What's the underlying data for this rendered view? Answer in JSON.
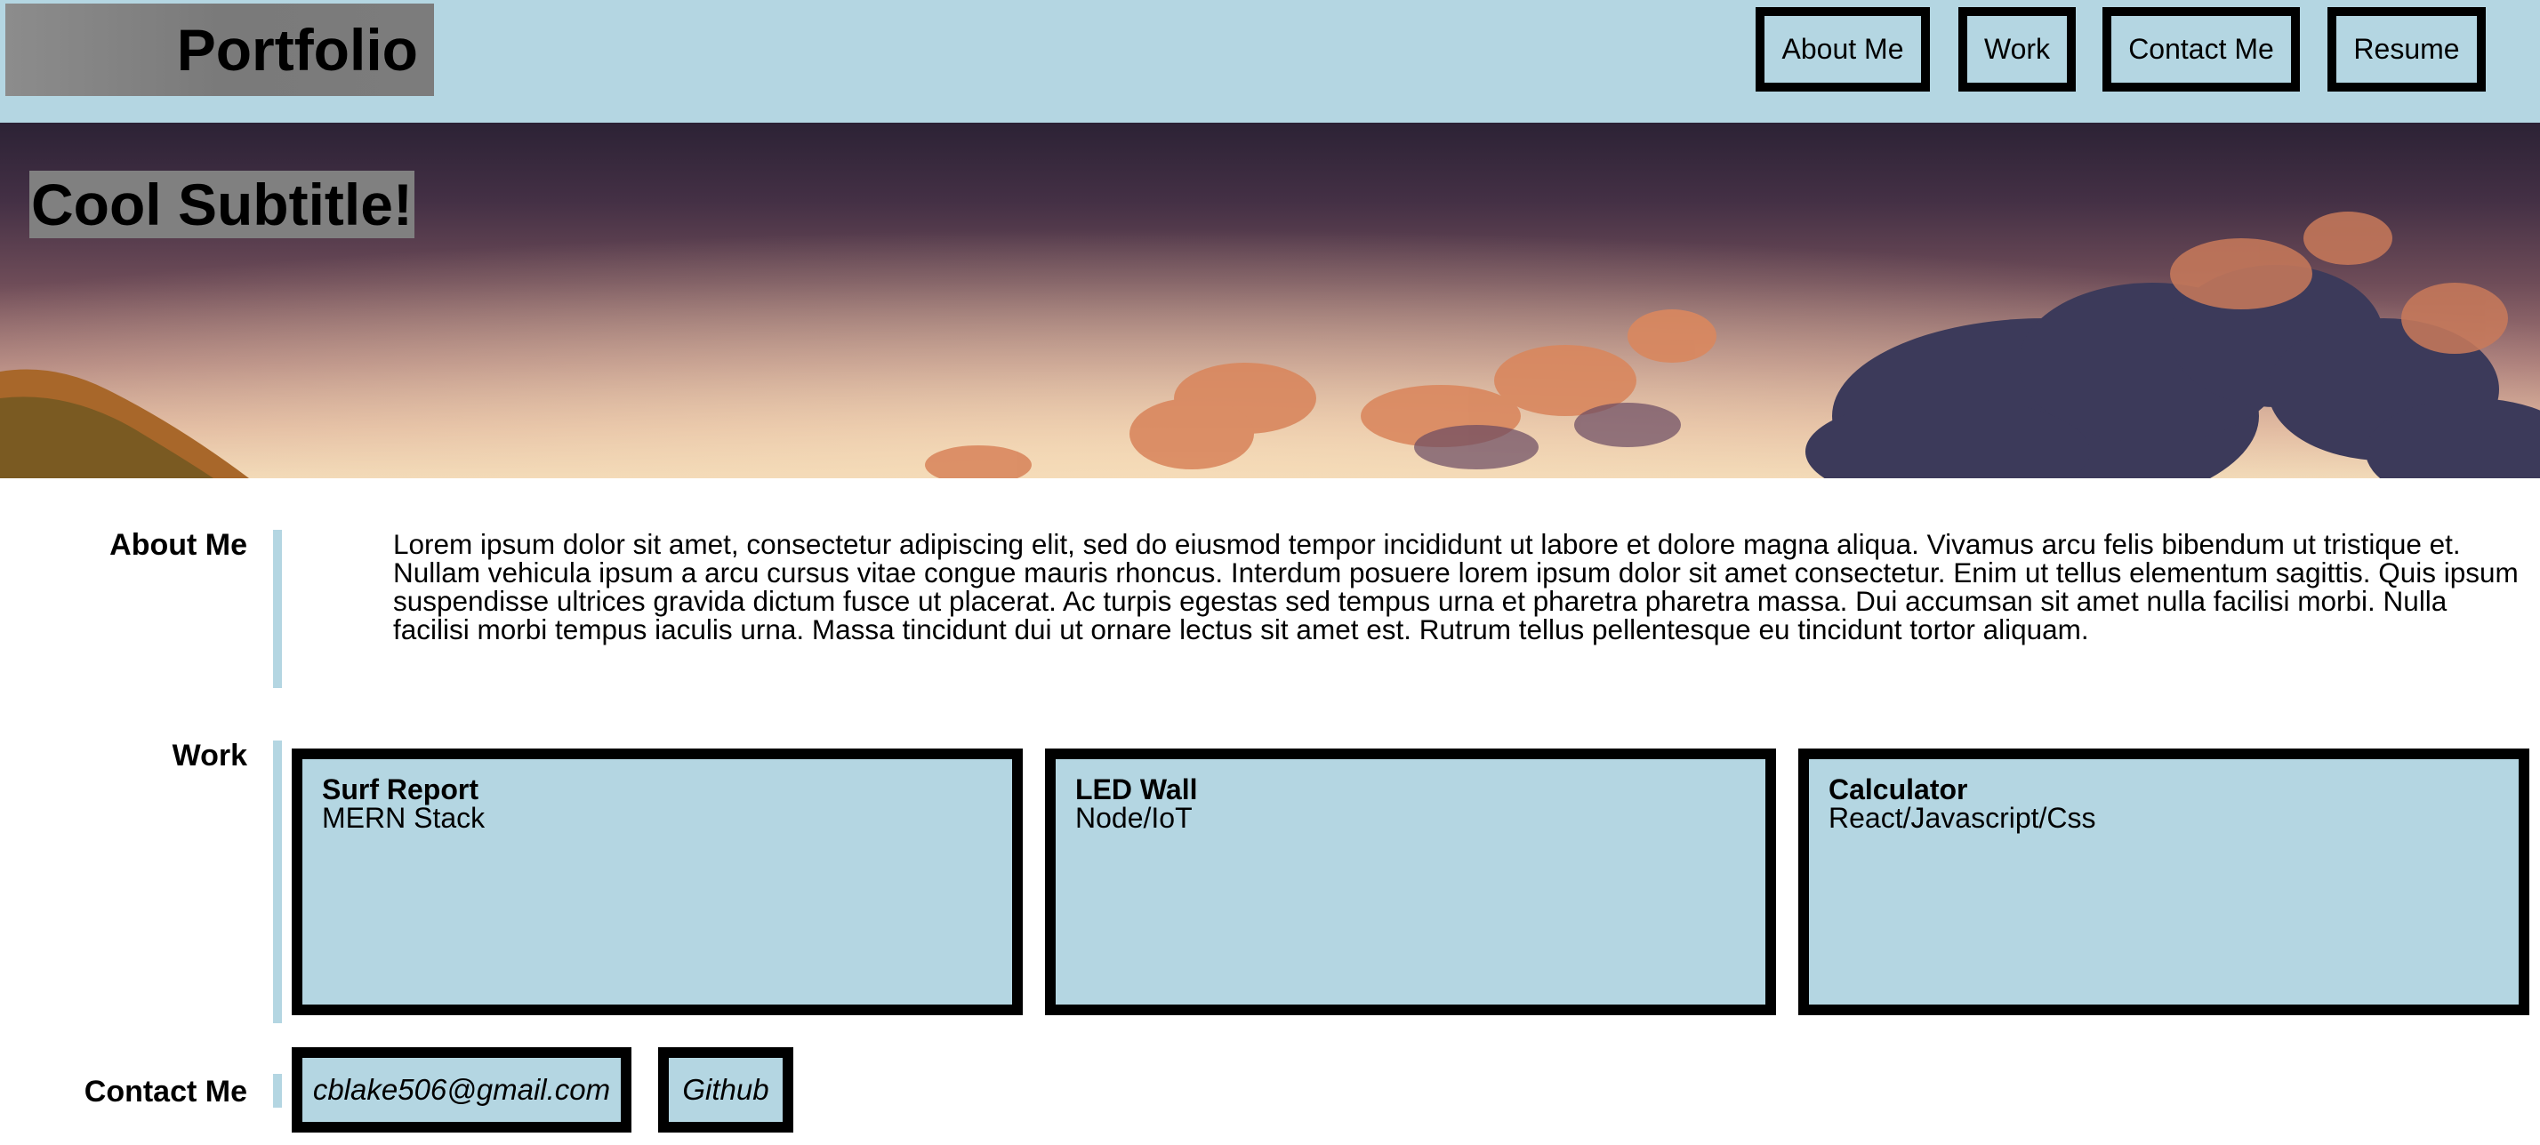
{
  "header": {
    "logo": "Portfolio",
    "nav": [
      "About Me",
      "Work",
      "Contact Me",
      "Resume"
    ]
  },
  "hero": {
    "subtitle": "Cool Subtitle!"
  },
  "about": {
    "label": "About Me",
    "text": "Lorem ipsum dolor sit amet, consectetur adipiscing elit, sed do eiusmod tempor incididunt ut labore et dolore magna aliqua. Vivamus arcu felis bibendum ut tristique et. Nullam vehicula ipsum a arcu cursus vitae congue mauris rhoncus. Interdum posuere lorem ipsum dolor sit amet consectetur. Enim ut tellus elementum sagittis. Quis ipsum suspendisse ultrices gravida dictum fusce ut placerat. Ac turpis egestas sed tempus urna et pharetra pharetra massa. Dui accumsan sit amet nulla facilisi morbi. Nulla facilisi morbi tempus iaculis urna. Massa tincidunt dui ut ornare lectus sit amet est. Rutrum tellus pellentesque eu tincidunt tortor aliquam."
  },
  "work": {
    "label": "Work",
    "projects": [
      {
        "title": "Surf Report",
        "stack": "MERN Stack"
      },
      {
        "title": "LED Wall",
        "stack": "Node/IoT"
      },
      {
        "title": "Calculator",
        "stack": "React/Javascript/Css"
      }
    ]
  },
  "contact": {
    "label": "Contact Me",
    "email": "cblake506@gmail.com",
    "github": "Github"
  },
  "colors": {
    "accent": "#b4d6e2",
    "border": "#000000",
    "logo_bg": "#808080"
  }
}
